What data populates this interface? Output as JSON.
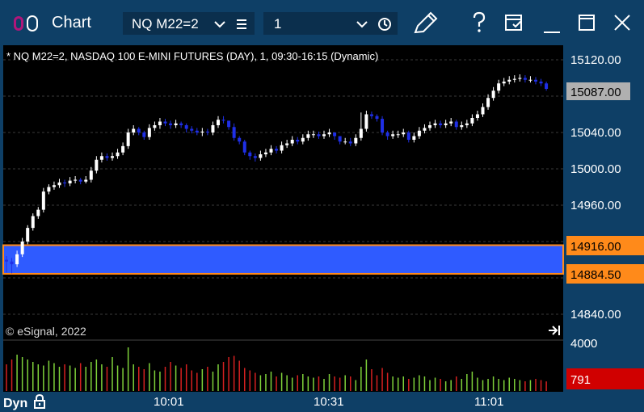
{
  "window": {
    "title": "Chart",
    "symbol": "NQ M22=2",
    "interval": "1"
  },
  "chart": {
    "header": "* NQ M22=2, NASDAQ 100 E-MINI FUTURES (DAY), 1, 09:30-16:15 (Dynamic)",
    "copyright": "© eSignal, 2022",
    "price_labels": [
      "15120.00",
      "15040.00",
      "15000.00",
      "14960.00",
      "14840.00"
    ],
    "last_price": "15087.00",
    "zone_upper": "14916.00",
    "zone_lower": "14884.50",
    "volume_label": "4000",
    "last_volume": "791",
    "time_labels": [
      "10:01",
      "10:31",
      "11:01"
    ],
    "mode_label": "Dyn",
    "colors": {
      "background": "#000000",
      "frame": "#0e3f66",
      "up": "#ffffff",
      "down": "#1f2fe6",
      "zone": "#2f5bff",
      "zone_border": "#ff8a1a",
      "last_price_bg": "#b0b0b0",
      "vol_up": "#7fd23a",
      "vol_down": "#d62020",
      "last_volume_bg": "#d00000"
    }
  },
  "chart_data": {
    "type": "candlestick",
    "x": [
      "09:30",
      "09:31",
      "09:32",
      "09:33",
      "09:34",
      "09:35",
      "09:36",
      "09:37",
      "09:38",
      "09:39",
      "09:40",
      "09:41",
      "09:42",
      "09:43",
      "09:44",
      "09:45",
      "09:46",
      "09:47",
      "09:48",
      "09:49",
      "09:50",
      "09:51",
      "09:52",
      "09:53",
      "09:54",
      "09:55",
      "09:56",
      "09:57",
      "09:58",
      "09:59",
      "10:00",
      "10:01",
      "10:02",
      "10:03",
      "10:04",
      "10:05",
      "10:06",
      "10:07",
      "10:08",
      "10:09",
      "10:10",
      "10:11",
      "10:12",
      "10:13",
      "10:14",
      "10:15",
      "10:16",
      "10:17",
      "10:18",
      "10:19",
      "10:20",
      "10:21",
      "10:22",
      "10:23",
      "10:24",
      "10:25",
      "10:26",
      "10:27",
      "10:28",
      "10:29",
      "10:30",
      "10:31",
      "10:32",
      "10:33",
      "10:34",
      "10:35",
      "10:36",
      "10:37",
      "10:38",
      "10:39",
      "10:40",
      "10:41",
      "10:42",
      "10:43",
      "10:44",
      "10:45",
      "10:46",
      "10:47",
      "10:48",
      "10:49",
      "10:50",
      "10:51",
      "10:52",
      "10:53",
      "10:54",
      "10:55",
      "10:56",
      "10:57",
      "10:58",
      "10:59",
      "11:00",
      "11:01",
      "11:02",
      "11:03",
      "11:04",
      "11:05",
      "11:06",
      "11:07",
      "11:08",
      "11:09",
      "11:10",
      "11:11",
      "11:12"
    ],
    "open": [
      14900,
      14898,
      14895,
      14906,
      14920,
      14935,
      14948,
      14955,
      14975,
      14980,
      14982,
      14985,
      14984,
      14987,
      14988,
      14986,
      14988,
      14998,
      15010,
      15014,
      15012,
      15014,
      15018,
      15025,
      15040,
      15044,
      15040,
      15035,
      15045,
      15048,
      15052,
      15050,
      15048,
      15050,
      15048,
      15044,
      15042,
      15040,
      15041,
      15040,
      15048,
      15054,
      15053,
      15046,
      15034,
      15030,
      15018,
      15014,
      15012,
      15016,
      15018,
      15022,
      15020,
      15026,
      15028,
      15032,
      15030,
      15034,
      15038,
      15038,
      15036,
      15038,
      15040,
      15036,
      15030,
      15030,
      15028,
      15034,
      15044,
      15060,
      15058,
      15055,
      15040,
      15036,
      15038,
      15038,
      15040,
      15032,
      15036,
      15042,
      15045,
      15048,
      15050,
      15048,
      15050,
      15052,
      15046,
      15048,
      15050,
      15056,
      15060,
      15068,
      15078,
      15086,
      15094,
      15096,
      15098,
      15099,
      15100,
      15098,
      15098,
      15096,
      15094
    ],
    "close": [
      14898,
      14895,
      14906,
      14920,
      14935,
      14948,
      14955,
      14975,
      14980,
      14982,
      14985,
      14984,
      14987,
      14988,
      14986,
      14988,
      14998,
      15010,
      15014,
      15012,
      15014,
      15018,
      15025,
      15040,
      15044,
      15040,
      15035,
      15045,
      15048,
      15052,
      15050,
      15048,
      15050,
      15048,
      15044,
      15042,
      15040,
      15041,
      15040,
      15048,
      15054,
      15053,
      15046,
      15034,
      15030,
      15018,
      15014,
      15012,
      15016,
      15018,
      15022,
      15020,
      15026,
      15028,
      15032,
      15030,
      15034,
      15038,
      15038,
      15036,
      15038,
      15040,
      15036,
      15030,
      15030,
      15028,
      15034,
      15044,
      15060,
      15058,
      15055,
      15040,
      15036,
      15038,
      15038,
      15040,
      15032,
      15036,
      15042,
      15045,
      15048,
      15050,
      15048,
      15050,
      15052,
      15046,
      15048,
      15050,
      15056,
      15060,
      15068,
      15078,
      15086,
      15094,
      15096,
      15098,
      15099,
      15100,
      15098,
      15098,
      15096,
      15094,
      15088
    ],
    "high": [
      14904,
      14902,
      14910,
      14924,
      14938,
      14951,
      14958,
      14979,
      14983,
      14986,
      14989,
      14988,
      14991,
      14992,
      14990,
      14992,
      15002,
      15014,
      15018,
      15017,
      15018,
      15022,
      15029,
      15044,
      15048,
      15046,
      15042,
      15049,
      15052,
      15056,
      15055,
      15053,
      15054,
      15052,
      15050,
      15047,
      15045,
      15045,
      15044,
      15052,
      15058,
      15058,
      15052,
      15050,
      15036,
      15032,
      15020,
      15017,
      15020,
      15022,
      15026,
      15025,
      15030,
      15032,
      15036,
      15035,
      15038,
      15042,
      15042,
      15041,
      15042,
      15044,
      15040,
      15036,
      15034,
      15034,
      15038,
      15062,
      15064,
      15063,
      15060,
      15058,
      15042,
      15042,
      15042,
      15044,
      15042,
      15040,
      15046,
      15049,
      15052,
      15054,
      15053,
      15054,
      15056,
      15054,
      15052,
      15054,
      15060,
      15064,
      15072,
      15082,
      15090,
      15098,
      15100,
      15102,
      15103,
      15104,
      15103,
      15102,
      15101,
      15099,
      15096
    ],
    "low": [
      14886,
      14885,
      14892,
      14903,
      14917,
      14932,
      14945,
      14952,
      14972,
      14977,
      14979,
      14980,
      14981,
      14984,
      14983,
      14984,
      14985,
      14995,
      15007,
      15009,
      15009,
      15011,
      15015,
      15022,
      15037,
      15037,
      15032,
      15032,
      15042,
      15044,
      15047,
      15044,
      15045,
      15045,
      15040,
      15039,
      15037,
      15036,
      15037,
      15037,
      15045,
      15050,
      15043,
      15031,
      15027,
      15015,
      15010,
      15008,
      15009,
      15013,
      15015,
      15017,
      15017,
      15023,
      15025,
      15027,
      15027,
      15031,
      15034,
      15033,
      15033,
      15035,
      15032,
      15027,
      15027,
      15025,
      15025,
      15031,
      15041,
      15055,
      15052,
      15037,
      15032,
      15033,
      15034,
      15035,
      15029,
      15029,
      15033,
      15039,
      15042,
      15045,
      15045,
      15045,
      15047,
      15043,
      15043,
      15045,
      15047,
      15053,
      15057,
      15065,
      15075,
      15083,
      15091,
      15093,
      15095,
      15096,
      15095,
      15095,
      15093,
      15091,
      15086
    ],
    "volume": [
      2200,
      2600,
      3000,
      2800,
      2600,
      2400,
      2200,
      2100,
      2500,
      2300,
      2000,
      2200,
      2100,
      1900,
      2300,
      2000,
      2400,
      2600,
      2200,
      2000,
      2800,
      2100,
      1900,
      3600,
      2200,
      2000,
      1800,
      2300,
      1700,
      1600,
      2000,
      2400,
      2100,
      1900,
      2200,
      1700,
      1500,
      1800,
      2000,
      1600,
      2200,
      2400,
      2800,
      2900,
      2500,
      1900,
      1700,
      1500,
      1300,
      1400,
      1600,
      1200,
      1500,
      1300,
      1100,
      1300,
      1400,
      1200,
      1100,
      1200,
      1000,
      1400,
      1200,
      1100,
      1300,
      1200,
      900,
      2000,
      2600,
      1800,
      1300,
      1900,
      1500,
      1200,
      1100,
      1200,
      1000,
      1100,
      1300,
      1200,
      900,
      1100,
      1000,
      800,
      900,
      1200,
      1000,
      1400,
      1600,
      1100,
      900,
      1000,
      1200,
      1000,
      900,
      1100,
      1000,
      900,
      800,
      900,
      1000,
      900,
      791
    ],
    "yrange": [
      14800,
      15140
    ],
    "volume_range": [
      0,
      4000
    ],
    "zone": [
      14884.5,
      14916.0
    ],
    "last_price": 15087.0
  }
}
